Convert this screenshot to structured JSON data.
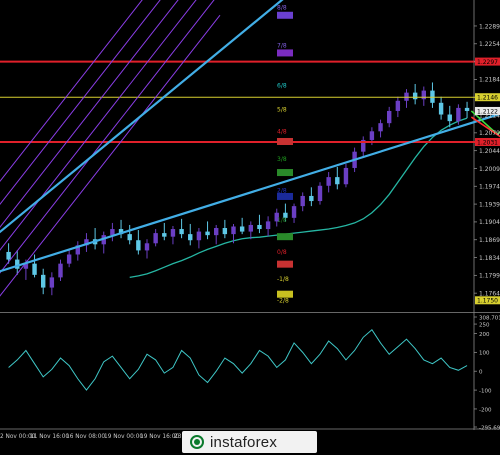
{
  "brand": {
    "name": "instaforex"
  },
  "colors": {
    "background": "#000000",
    "candle_up": "#6b3fc4",
    "candle_down": "#5ec8e6",
    "channel": "#8a3de6",
    "trend_line": "#42aee6",
    "level_red": "#e0202a",
    "moving_average": "#26b6a3",
    "forecast_arrow": "#3ddc3d",
    "forecast_alt": "#ff3030",
    "osc_line": "#3fc7c7",
    "tick_text": "#c8c8c8"
  },
  "chart_data": [
    {
      "type": "candlestick",
      "panel": "price",
      "y_ticks": [
        "1.2289",
        "1.2254",
        "1.2219",
        "1.2184",
        "1.2114",
        "1.2079",
        "1.2044",
        "1.2009",
        "1.1974",
        "1.1939",
        "1.1904",
        "1.1869",
        "1.1834",
        "1.1799",
        "1.1764",
        "1.1727"
      ],
      "ylim": [
        1.1727,
        1.234
      ],
      "price_labels": [
        {
          "text": "1.2297",
          "value": 1.2219,
          "color": "#e0202a"
        },
        {
          "text": "1.2146",
          "value": 1.2149,
          "color": "#d8d030"
        },
        {
          "text": "1.2122",
          "value": 1.2122,
          "color": "#e8e8e8"
        },
        {
          "text": "1.2031",
          "value": 1.2061,
          "color": "#e0202a"
        },
        {
          "text": "1.1750",
          "value": 1.175,
          "color": "#d8d030"
        }
      ],
      "murray_labels": [
        {
          "text": "8/8",
          "value": 1.2326,
          "color": "#8060e0"
        },
        {
          "text": "7/8",
          "value": 1.2251,
          "color": "#8060e0"
        },
        {
          "text": "6/8",
          "value": 1.2173,
          "color": "#20c8c8"
        },
        {
          "text": "5/8",
          "value": 1.2125,
          "color": "#d8d030"
        },
        {
          "text": "4/8",
          "value": 1.2082,
          "color": "#e0202a"
        },
        {
          "text": "3/8",
          "value": 1.2028,
          "color": "#20a020"
        },
        {
          "text": "2/8",
          "value": 1.1966,
          "color": "#2030c0"
        },
        {
          "text": "1/8",
          "value": 1.1908,
          "color": "#208020"
        },
        {
          "text": "0/8",
          "value": 1.1845,
          "color": "#e0202a"
        },
        {
          "text": "-1/8",
          "value": 1.1792,
          "color": "#d8d030"
        },
        {
          "text": "-2/8",
          "value": 1.175,
          "color": "#d8d030"
        }
      ],
      "murray_tags": [
        {
          "value": 1.231,
          "color": "#6a40d0"
        },
        {
          "value": 1.2236,
          "color": "#7a2cc0"
        },
        {
          "value": 1.2062,
          "color": "#c83232"
        },
        {
          "value": 1.2001,
          "color": "#2a8a2a"
        },
        {
          "value": 1.1954,
          "color": "#1a2a9a"
        },
        {
          "value": 1.1875,
          "color": "#2a8a2a"
        },
        {
          "value": 1.1821,
          "color": "#c83232"
        },
        {
          "value": 1.1762,
          "color": "#c8c020"
        }
      ],
      "horizontal_levels": [
        {
          "value": 1.2219,
          "color": "#e0202a"
        },
        {
          "value": 1.2149,
          "color": "#d8d030"
        },
        {
          "value": 1.2061,
          "color": "#e0202a"
        }
      ],
      "candles": [
        {
          "o": 1.1845,
          "h": 1.1862,
          "l": 1.1822,
          "c": 1.183
        },
        {
          "o": 1.183,
          "h": 1.1848,
          "l": 1.18,
          "c": 1.1812
        },
        {
          "o": 1.1812,
          "h": 1.183,
          "l": 1.179,
          "c": 1.1822
        },
        {
          "o": 1.1822,
          "h": 1.184,
          "l": 1.1795,
          "c": 1.18
        },
        {
          "o": 1.18,
          "h": 1.1812,
          "l": 1.1762,
          "c": 1.1775
        },
        {
          "o": 1.1775,
          "h": 1.1805,
          "l": 1.176,
          "c": 1.1795
        },
        {
          "o": 1.1795,
          "h": 1.183,
          "l": 1.1788,
          "c": 1.1822
        },
        {
          "o": 1.1822,
          "h": 1.1848,
          "l": 1.1815,
          "c": 1.184
        },
        {
          "o": 1.184,
          "h": 1.1866,
          "l": 1.1828,
          "c": 1.1858
        },
        {
          "o": 1.1858,
          "h": 1.1882,
          "l": 1.1845,
          "c": 1.187
        },
        {
          "o": 1.187,
          "h": 1.1892,
          "l": 1.185,
          "c": 1.186
        },
        {
          "o": 1.186,
          "h": 1.1885,
          "l": 1.1842,
          "c": 1.1878
        },
        {
          "o": 1.1878,
          "h": 1.1902,
          "l": 1.1866,
          "c": 1.189
        },
        {
          "o": 1.189,
          "h": 1.1908,
          "l": 1.1872,
          "c": 1.188
        },
        {
          "o": 1.188,
          "h": 1.1898,
          "l": 1.186,
          "c": 1.1868
        },
        {
          "o": 1.1868,
          "h": 1.1888,
          "l": 1.184,
          "c": 1.1848
        },
        {
          "o": 1.1848,
          "h": 1.187,
          "l": 1.1832,
          "c": 1.1862
        },
        {
          "o": 1.1862,
          "h": 1.189,
          "l": 1.1856,
          "c": 1.1882
        },
        {
          "o": 1.1882,
          "h": 1.1902,
          "l": 1.1868,
          "c": 1.1875
        },
        {
          "o": 1.1875,
          "h": 1.1896,
          "l": 1.186,
          "c": 1.189
        },
        {
          "o": 1.189,
          "h": 1.191,
          "l": 1.1872,
          "c": 1.188
        },
        {
          "o": 1.188,
          "h": 1.19,
          "l": 1.1858,
          "c": 1.1868
        },
        {
          "o": 1.1868,
          "h": 1.1892,
          "l": 1.1852,
          "c": 1.1885
        },
        {
          "o": 1.1885,
          "h": 1.1905,
          "l": 1.187,
          "c": 1.1878
        },
        {
          "o": 1.1878,
          "h": 1.1898,
          "l": 1.186,
          "c": 1.1892
        },
        {
          "o": 1.1892,
          "h": 1.1908,
          "l": 1.1872,
          "c": 1.188
        },
        {
          "o": 1.188,
          "h": 1.19,
          "l": 1.1862,
          "c": 1.1895
        },
        {
          "o": 1.1895,
          "h": 1.1912,
          "l": 1.188,
          "c": 1.1885
        },
        {
          "o": 1.1885,
          "h": 1.1905,
          "l": 1.187,
          "c": 1.1898
        },
        {
          "o": 1.1898,
          "h": 1.1918,
          "l": 1.1882,
          "c": 1.189
        },
        {
          "o": 1.189,
          "h": 1.1915,
          "l": 1.1876,
          "c": 1.1905
        },
        {
          "o": 1.1905,
          "h": 1.193,
          "l": 1.1895,
          "c": 1.1922
        },
        {
          "o": 1.1922,
          "h": 1.194,
          "l": 1.1905,
          "c": 1.1912
        },
        {
          "o": 1.1912,
          "h": 1.194,
          "l": 1.1902,
          "c": 1.1935
        },
        {
          "o": 1.1935,
          "h": 1.1962,
          "l": 1.1925,
          "c": 1.1955
        },
        {
          "o": 1.1955,
          "h": 1.1972,
          "l": 1.1935,
          "c": 1.1945
        },
        {
          "o": 1.1945,
          "h": 1.1982,
          "l": 1.1938,
          "c": 1.1975
        },
        {
          "o": 1.1975,
          "h": 1.2002,
          "l": 1.1962,
          "c": 1.1992
        },
        {
          "o": 1.1992,
          "h": 1.2012,
          "l": 1.1968,
          "c": 1.1978
        },
        {
          "o": 1.1978,
          "h": 1.2018,
          "l": 1.1972,
          "c": 1.201
        },
        {
          "o": 1.201,
          "h": 1.205,
          "l": 1.2002,
          "c": 1.2042
        },
        {
          "o": 1.2042,
          "h": 1.2072,
          "l": 1.203,
          "c": 1.2065
        },
        {
          "o": 1.2065,
          "h": 1.209,
          "l": 1.2055,
          "c": 1.2082
        },
        {
          "o": 1.2082,
          "h": 1.2105,
          "l": 1.207,
          "c": 1.2098
        },
        {
          "o": 1.2098,
          "h": 1.213,
          "l": 1.209,
          "c": 1.2122
        },
        {
          "o": 1.2122,
          "h": 1.215,
          "l": 1.211,
          "c": 1.2142
        },
        {
          "o": 1.2142,
          "h": 1.2165,
          "l": 1.2128,
          "c": 1.2158
        },
        {
          "o": 1.2158,
          "h": 1.2175,
          "l": 1.2135,
          "c": 1.2145
        },
        {
          "o": 1.2145,
          "h": 1.217,
          "l": 1.2132,
          "c": 1.2162
        },
        {
          "o": 1.2162,
          "h": 1.2178,
          "l": 1.2128,
          "c": 1.2138
        },
        {
          "o": 1.2138,
          "h": 1.215,
          "l": 1.2105,
          "c": 1.2115
        },
        {
          "o": 1.2115,
          "h": 1.2132,
          "l": 1.209,
          "c": 1.2102
        },
        {
          "o": 1.2102,
          "h": 1.2135,
          "l": 1.2095,
          "c": 1.2128
        },
        {
          "o": 1.2128,
          "h": 1.214,
          "l": 1.2108,
          "c": 1.2122
        }
      ],
      "moving_average": [
        1.1795,
        1.1798,
        1.1802,
        1.1808,
        1.1815,
        1.1822,
        1.1828,
        1.1835,
        1.1843,
        1.185,
        1.1856,
        1.1862,
        1.1867,
        1.1871,
        1.1873,
        1.1874,
        1.1876,
        1.1878,
        1.188,
        1.1882,
        1.1884,
        1.1886,
        1.1888,
        1.189,
        1.1893,
        1.1897,
        1.1902,
        1.191,
        1.1922,
        1.1938,
        1.1958,
        1.1982,
        1.2006,
        1.203,
        1.2052,
        1.207,
        1.2084,
        1.2094,
        1.2102,
        1.2108
      ],
      "forecast_path": [
        {
          "t": 53.5,
          "v": 1.2122
        },
        {
          "t": 56.5,
          "v": 1.2076
        },
        {
          "t": 60.5,
          "v": 1.214
        },
        {
          "t": 63.5,
          "v": 1.2102
        },
        {
          "t": 69.5,
          "v": 1.2202
        },
        {
          "t": 72.5,
          "v": 1.2172
        }
      ],
      "forecast_alt_path": [
        {
          "t": 53.5,
          "v": 1.211
        },
        {
          "t": 63.5,
          "v": 1.1995
        },
        {
          "t": 67.5,
          "v": 1.203
        }
      ]
    },
    {
      "type": "line",
      "panel": "oscillator",
      "y_ticks": [
        "308.7018",
        "250",
        "200",
        "100",
        "0",
        "-100",
        "-200",
        "-295.695"
      ],
      "ylim": [
        -295.695,
        308.7018
      ],
      "values": [
        20,
        60,
        110,
        40,
        -30,
        10,
        70,
        30,
        -40,
        -100,
        -40,
        50,
        80,
        20,
        -40,
        10,
        90,
        60,
        -10,
        20,
        110,
        70,
        -20,
        -60,
        0,
        70,
        40,
        -10,
        40,
        110,
        80,
        20,
        60,
        150,
        100,
        40,
        90,
        160,
        120,
        60,
        110,
        180,
        220,
        150,
        90,
        130,
        170,
        120,
        60,
        40,
        70,
        20,
        5,
        30
      ]
    }
  ],
  "x_axis": {
    "labels": [
      "2 Nov 00:00",
      "11 Nov 16:00",
      "16 Nov 08:00",
      "19 Nov 00:00",
      "19 Nov 16:00",
      "23 Nov 16:00"
    ]
  }
}
